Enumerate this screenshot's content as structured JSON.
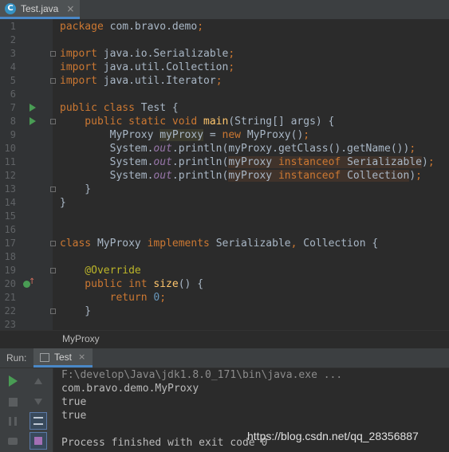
{
  "editor_tab": {
    "label": "Test.java",
    "icon_letter": "C",
    "close": "×"
  },
  "breadcrumb": "MyProxy",
  "run_window": {
    "label": "Run:",
    "tab_label": "Test",
    "tab_close": "×",
    "console": [
      "F:\\develop\\Java\\jdk1.8.0_171\\bin\\java.exe ...",
      "com.bravo.demo.MyProxy",
      "true",
      "true",
      "",
      "Process finished with exit code 0"
    ]
  },
  "watermark": "https://blog.csdn.net/qq_28356887",
  "colors": {
    "keyword": "#cc7832",
    "method": "#ffc66d",
    "static_field": "#9876aa",
    "annotation": "#bbb529",
    "number": "#6897bb",
    "text": "#a9b7c6",
    "run_green": "#499c54"
  },
  "code_lines": [
    {
      "n": "1",
      "tokens": [
        {
          "t": "package ",
          "c": "kw"
        },
        {
          "t": "com.bravo.demo",
          "c": ""
        },
        {
          "t": ";",
          "c": "kw"
        }
      ]
    },
    {
      "n": "2",
      "tokens": []
    },
    {
      "n": "3",
      "fold": true,
      "tokens": [
        {
          "t": "import ",
          "c": "kw"
        },
        {
          "t": "java.io.Serializable",
          "c": ""
        },
        {
          "t": ";",
          "c": "kw"
        }
      ]
    },
    {
      "n": "4",
      "tokens": [
        {
          "t": "import ",
          "c": "kw"
        },
        {
          "t": "java.util.Collection",
          "c": ""
        },
        {
          "t": ";",
          "c": "kw"
        }
      ]
    },
    {
      "n": "5",
      "fold": true,
      "tokens": [
        {
          "t": "import ",
          "c": "kw"
        },
        {
          "t": "java.util.Iterator",
          "c": ""
        },
        {
          "t": ";",
          "c": "kw"
        }
      ]
    },
    {
      "n": "6",
      "tokens": []
    },
    {
      "n": "7",
      "run": true,
      "tokens": [
        {
          "t": "public class ",
          "c": "kw"
        },
        {
          "t": "Test {",
          "c": ""
        }
      ]
    },
    {
      "n": "8",
      "run": true,
      "fold": true,
      "tokens": [
        {
          "t": "    public static void ",
          "c": "kw"
        },
        {
          "t": "main",
          "c": "fn"
        },
        {
          "t": "(String[] args) {",
          "c": ""
        }
      ]
    },
    {
      "n": "9",
      "tokens": [
        {
          "t": "        MyProxy ",
          "c": ""
        },
        {
          "t": "myProxy",
          "c": "hl"
        },
        {
          "t": " = ",
          "c": ""
        },
        {
          "t": "new ",
          "c": "kw"
        },
        {
          "t": "MyProxy()",
          "c": ""
        },
        {
          "t": ";",
          "c": "kw"
        }
      ]
    },
    {
      "n": "10",
      "tokens": [
        {
          "t": "        System.",
          "c": ""
        },
        {
          "t": "out",
          "c": "it"
        },
        {
          "t": ".println(myProxy.getClass().getName())",
          "c": ""
        },
        {
          "t": ";",
          "c": "kw"
        }
      ]
    },
    {
      "n": "11",
      "tokens": [
        {
          "t": "        System.",
          "c": ""
        },
        {
          "t": "out",
          "c": "it"
        },
        {
          "t": ".println(",
          "c": ""
        },
        {
          "t": "myProxy ",
          "c": "hl2"
        },
        {
          "t": "instanceof ",
          "c": "kw hl2"
        },
        {
          "t": "Serializable",
          "c": "hl2"
        },
        {
          "t": ")",
          "c": ""
        },
        {
          "t": ";",
          "c": "kw"
        }
      ]
    },
    {
      "n": "12",
      "tokens": [
        {
          "t": "        System.",
          "c": ""
        },
        {
          "t": "out",
          "c": "it"
        },
        {
          "t": ".println(",
          "c": ""
        },
        {
          "t": "myProxy ",
          "c": "hl2"
        },
        {
          "t": "instanceof ",
          "c": "kw hl2"
        },
        {
          "t": "Collection",
          "c": "hl2"
        },
        {
          "t": ")",
          "c": ""
        },
        {
          "t": ";",
          "c": "kw"
        }
      ]
    },
    {
      "n": "13",
      "fold": true,
      "tokens": [
        {
          "t": "    }",
          "c": ""
        }
      ]
    },
    {
      "n": "14",
      "tokens": [
        {
          "t": "}",
          "c": ""
        }
      ]
    },
    {
      "n": "15",
      "tokens": []
    },
    {
      "n": "16",
      "tokens": []
    },
    {
      "n": "17",
      "fold": true,
      "tokens": [
        {
          "t": "class ",
          "c": "kw"
        },
        {
          "t": "MyProxy ",
          "c": ""
        },
        {
          "t": "implements ",
          "c": "kw"
        },
        {
          "t": "Serializable",
          "c": ""
        },
        {
          "t": ", ",
          "c": "kw"
        },
        {
          "t": "Collection {",
          "c": ""
        }
      ]
    },
    {
      "n": "18",
      "tokens": []
    },
    {
      "n": "19",
      "fold": true,
      "tokens": [
        {
          "t": "    @Override",
          "c": "ann"
        }
      ]
    },
    {
      "n": "20",
      "override": true,
      "tokens": [
        {
          "t": "    public int ",
          "c": "kw"
        },
        {
          "t": "size",
          "c": "fn"
        },
        {
          "t": "() {",
          "c": ""
        }
      ]
    },
    {
      "n": "21",
      "tokens": [
        {
          "t": "        return ",
          "c": "kw"
        },
        {
          "t": "0",
          "c": "num"
        },
        {
          "t": ";",
          "c": "kw"
        }
      ]
    },
    {
      "n": "22",
      "fold": true,
      "tokens": [
        {
          "t": "    }",
          "c": ""
        }
      ]
    },
    {
      "n": "23",
      "tokens": []
    }
  ]
}
